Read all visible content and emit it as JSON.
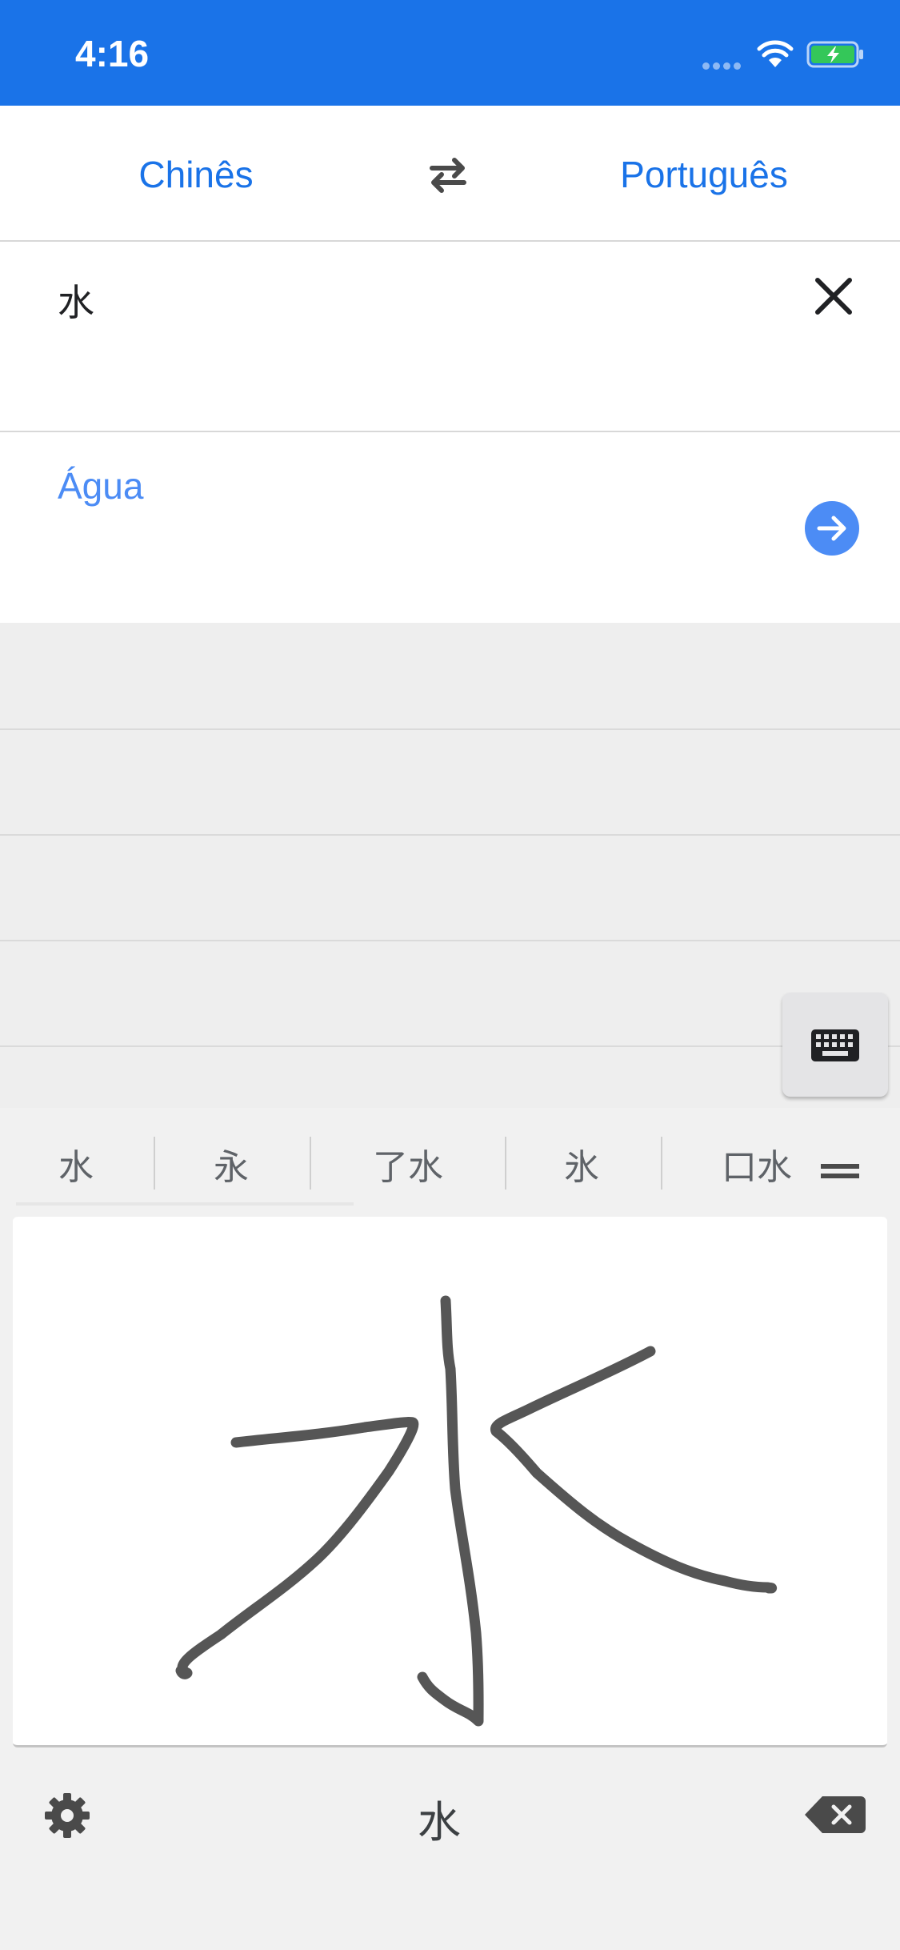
{
  "status_bar": {
    "time": "4:16",
    "background_color": "#1a73e8",
    "icons": [
      "cellular-dots-icon",
      "wifi-icon",
      "battery-charging-icon"
    ]
  },
  "language_bar": {
    "source_language": "Chinês",
    "target_language": "Português",
    "swap_icon": "swap-arrows-icon"
  },
  "input": {
    "text": "水",
    "clear_icon": "close-icon"
  },
  "output": {
    "translation": "Água",
    "go_icon": "arrow-forward-icon",
    "accent_color": "#4c8cf5"
  },
  "handwriting": {
    "candidates": [
      "水",
      "永",
      "了水",
      "氷",
      "口水"
    ],
    "more_icon": "menu-lines-icon",
    "keyboard_icon": "keyboard-icon",
    "settings_icon": "gear-icon",
    "preview": "水",
    "backspace_icon": "backspace-icon",
    "ink_color": "#565656"
  }
}
